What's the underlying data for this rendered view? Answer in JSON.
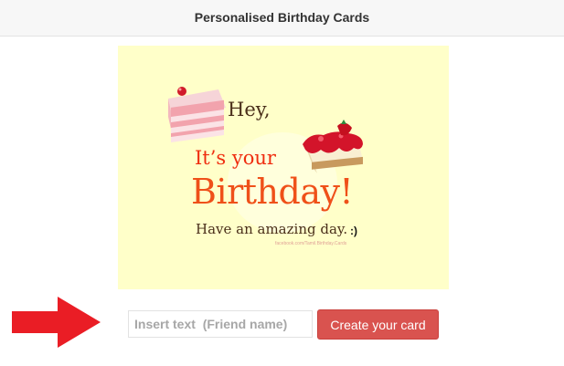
{
  "header": {
    "title": "Personalised Birthday Cards"
  },
  "card": {
    "line1": "Hey,",
    "line2": "It’s your",
    "line3": "Birthday!",
    "line4": "Have an amazing day.",
    "smiley": ":)",
    "watermark": "facebook.com/Tamil.Birthday.Cards",
    "background_color": "#ffffc9"
  },
  "form": {
    "name_placeholder": "Insert text  (Friend name)",
    "name_value": "",
    "submit_label": "Create your card",
    "submit_color": "#d9534f"
  },
  "indicator": {
    "arrow_color": "#ea1d25"
  }
}
